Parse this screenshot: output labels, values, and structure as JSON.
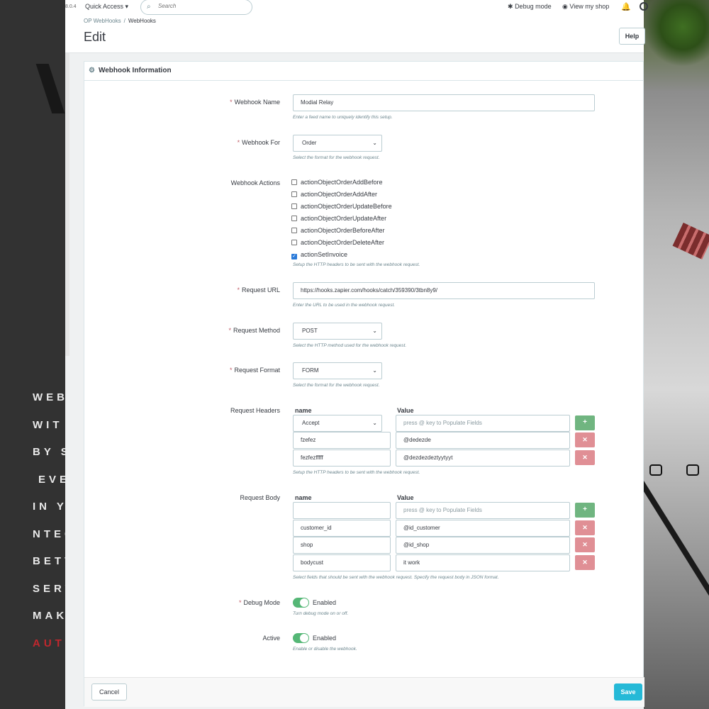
{
  "app": {
    "version": "8.0.4"
  },
  "topbar": {
    "quick_access": "Quick Access",
    "search_placeholder": "Search",
    "debug_mode": "Debug mode",
    "view_shop": "View my shop"
  },
  "breadcrumb": {
    "parent": "OP WebHooks",
    "current": "WebHooks"
  },
  "page": {
    "title": "Edit",
    "help": "Help"
  },
  "card": {
    "title": "Webhook Information"
  },
  "form": {
    "name": {
      "label": "Webhook Name",
      "value": "Modial Relay",
      "help": "Enter a feed name to uniquely identify this setup."
    },
    "for": {
      "label": "Webhook For",
      "value": "Order",
      "help": "Select the format for the webhook request."
    },
    "actions": {
      "label": "Webhook Actions",
      "items": [
        {
          "label": "actionObjectOrderAddBefore",
          "checked": false
        },
        {
          "label": "actionObjectOrderAddAfter",
          "checked": false
        },
        {
          "label": "actionObjectOrderUpdateBefore",
          "checked": false
        },
        {
          "label": "actionObjectOrderUpdateAfter",
          "checked": false
        },
        {
          "label": "actionObjectOrderBeforeAfter",
          "checked": false
        },
        {
          "label": "actionObjectOrderDeleteAfter",
          "checked": false
        },
        {
          "label": "actionSetInvoice",
          "checked": true
        }
      ],
      "help": "Setup the HTTP headers to be sent with the webhook request."
    },
    "url": {
      "label": "Request URL",
      "value": "https://hooks.zapier.com/hooks/catch/359390/3tbn8y9/",
      "help": "Enter the URL to be used in the webhook request."
    },
    "method": {
      "label": "Request Method",
      "value": "POST",
      "help": "Select the HTTP method used for the webhook request."
    },
    "format": {
      "label": "Request Format",
      "value": "FORM",
      "help": "Select the format for the webhook request."
    },
    "headers": {
      "label": "Request Headers",
      "col_name": "name",
      "col_value": "Value",
      "first_name": "Accept",
      "value_placeholder": "press @ key to Populate Fields",
      "rows": [
        {
          "name": "fzefez",
          "value": "@dedezde"
        },
        {
          "name": "fezfezfffff",
          "value": "@dezdezdeztyytyyt"
        }
      ],
      "help": "Setup the HTTP headers to be sent with the webhook request."
    },
    "body": {
      "label": "Request Body",
      "col_name": "name",
      "col_value": "Value",
      "value_placeholder": "press @ key to Populate Fields",
      "rows": [
        {
          "name": "customer_id",
          "value": "@id_customer"
        },
        {
          "name": "shop",
          "value": "@id_shop"
        },
        {
          "name": "bodycust",
          "value": "it work"
        }
      ],
      "help": "Select fields that should be sent with the webhook request. Specify the request body in JSON format."
    },
    "debug": {
      "label": "Debug Mode",
      "state": "Enabled",
      "help": "Turn debug mode on or off."
    },
    "active": {
      "label": "Active",
      "state": "Enabled",
      "help": "Enable or disable the webhook."
    }
  },
  "footer": {
    "cancel": "Cancel",
    "save": "Save"
  },
  "background_promo": [
    "WEB",
    "WIT",
    "BY S",
    "EVE",
    "IN Y",
    "NTEG",
    "BETV",
    "SERV",
    "MAK",
    "AUT"
  ],
  "colors": {
    "accent": "#25b9d7",
    "add": "#70b580",
    "delete": "#e08f95",
    "toggle": "#55b776",
    "required": "#c05c67"
  }
}
